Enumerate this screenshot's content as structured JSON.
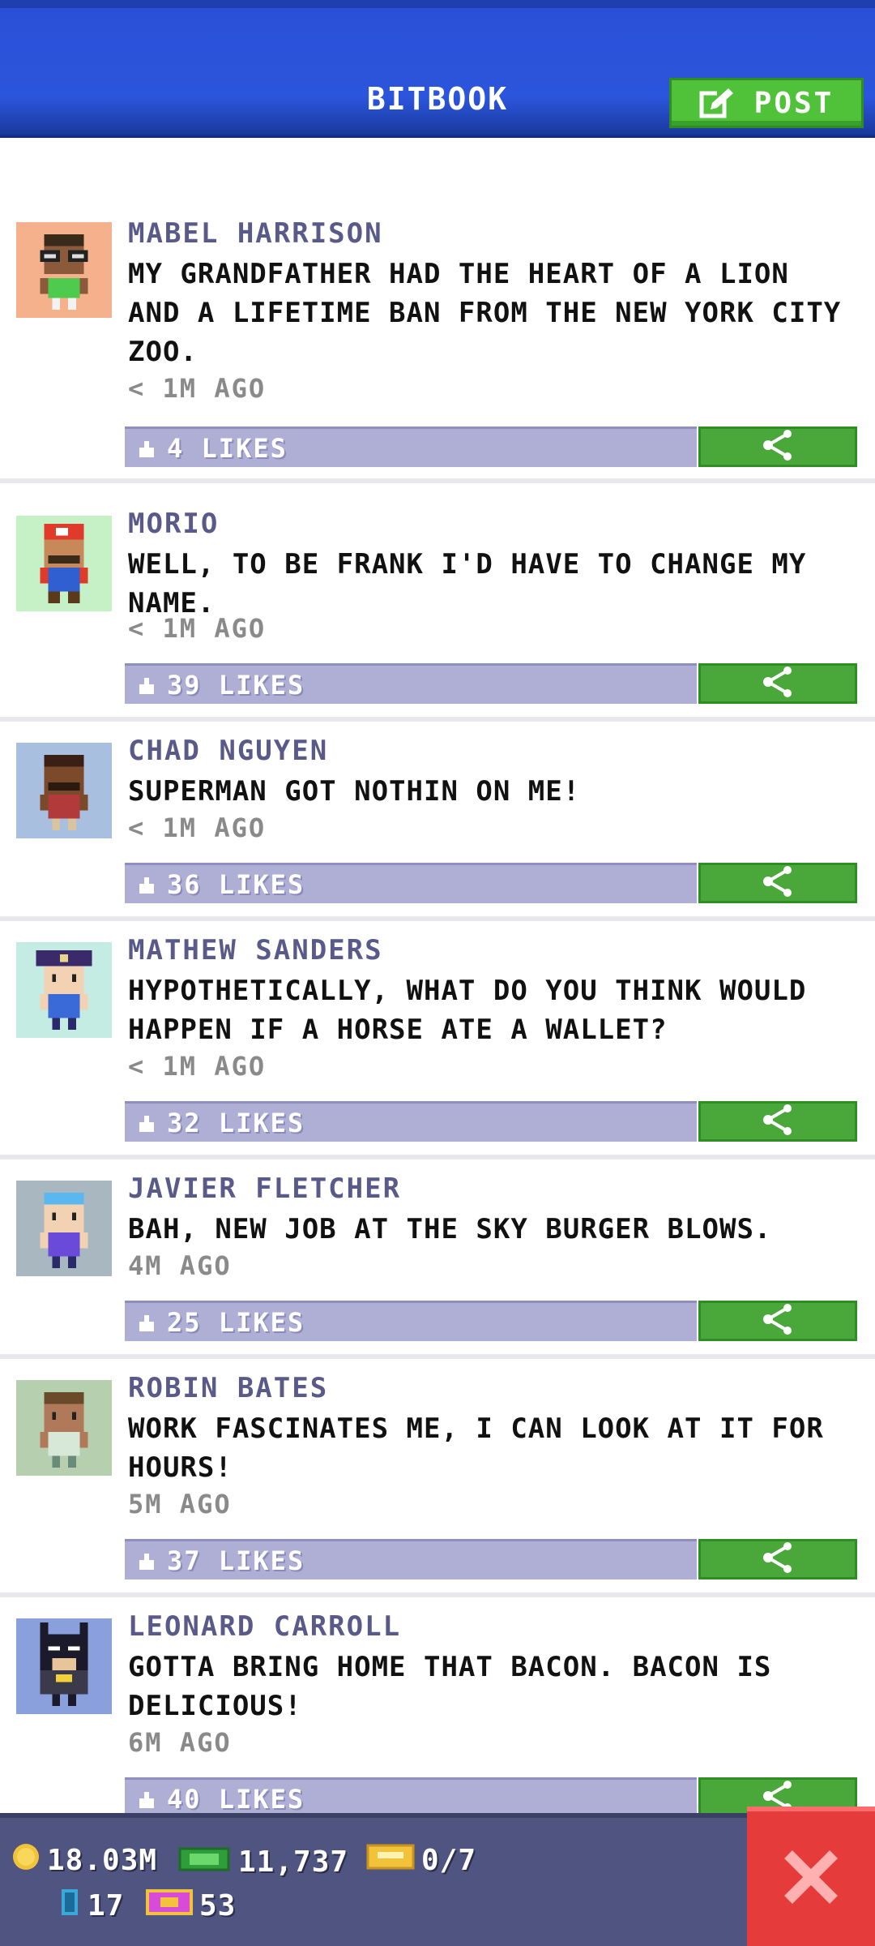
{
  "header": {
    "title": "BITBOOK",
    "post_label": "POST"
  },
  "posts": [
    {
      "author": "MABEL HARRISON",
      "message": "MY GRANDFATHER HAD THE HEART OF A LION AND A LIFETIME BAN FROM THE NEW YORK CITY ZOO.",
      "time": "< 1M AGO",
      "likes": "4 LIKES",
      "avatar_icon": "avatar-icon"
    },
    {
      "author": "MORIO",
      "message": "WELL, TO BE FRANK I'D HAVE TO CHANGE MY NAME.",
      "time": "< 1M AGO",
      "likes": "39 LIKES",
      "avatar_icon": "avatar-icon"
    },
    {
      "author": "CHAD NGUYEN",
      "message": "SUPERMAN GOT NOTHIN ON ME!",
      "time": "< 1M AGO",
      "likes": "36 LIKES",
      "avatar_icon": "avatar-icon"
    },
    {
      "author": "MATHEW SANDERS",
      "message": "HYPOTHETICALLY, WHAT DO YOU THINK WOULD HAPPEN IF A HORSE ATE A WALLET?",
      "time": "< 1M AGO",
      "likes": "32 LIKES",
      "avatar_icon": "avatar-icon"
    },
    {
      "author": "JAVIER FLETCHER",
      "message": "BAH, NEW JOB AT THE SKY BURGER BLOWS.",
      "time": "4M AGO",
      "likes": "25 LIKES",
      "avatar_icon": "avatar-icon"
    },
    {
      "author": "ROBIN BATES",
      "message": "WORK FASCINATES ME, I CAN LOOK AT IT FOR HOURS!",
      "time": "5M AGO",
      "likes": "37 LIKES",
      "avatar_icon": "avatar-icon"
    },
    {
      "author": "LEONARD CARROLL",
      "message": "GOTTA BRING HOME THAT BACON. BACON IS DELICIOUS!",
      "time": "6M AGO",
      "likes": "40 LIKES",
      "avatar_icon": "avatar-icon"
    }
  ],
  "status": {
    "coins": "18.03M",
    "bux": "11,737",
    "vip": "0/7",
    "floors": "17",
    "tickets": "53"
  },
  "colors": {
    "header": "#2b55dc",
    "post_green": "#4fc23a",
    "like_bar": "#afafd6",
    "author": "#5a5a8a",
    "close_red": "#e53b3b"
  }
}
